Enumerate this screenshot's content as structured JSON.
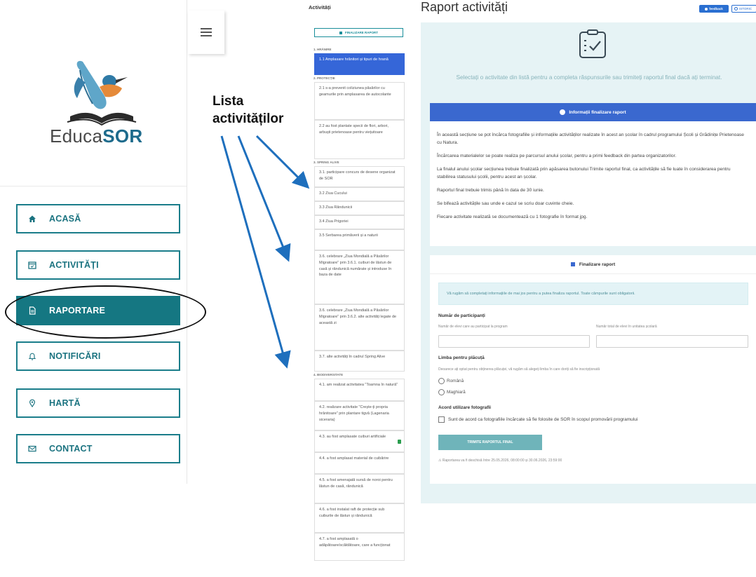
{
  "sidebar": {
    "logo_text_a": "Educa",
    "logo_text_b": "SOR",
    "nav": [
      {
        "label": "ACASĂ",
        "icon": "home-icon"
      },
      {
        "label": "ACTIVITĂȚI",
        "icon": "calendar-icon"
      },
      {
        "label": "RAPORTARE",
        "icon": "document-icon"
      },
      {
        "label": "NOTIFICĂRI",
        "icon": "bell-icon"
      },
      {
        "label": "HARTĂ",
        "icon": "map-pin-icon"
      },
      {
        "label": "CONTACT",
        "icon": "mail-icon"
      }
    ],
    "active": "RAPORTARE"
  },
  "annotation": {
    "line1": "Lista",
    "line2": "activităților"
  },
  "activities": {
    "title": "Activități",
    "finalize_button": "FINALIZARE RAPORT",
    "sections": [
      {
        "heading": "1. HRĂNIRE",
        "items": [
          {
            "text": "1.1 Amplasare hrănitori și tipuri de hrană",
            "active": true
          }
        ]
      },
      {
        "heading": "2. PROTECȚIE",
        "items": [
          {
            "text": "2.1 s-a prevenit coliziunea păsărilor cu geamurile prin amplasarea de autocolante"
          },
          {
            "text": "2.2 au fost plantate specii de flori, arbori, arbuști prietenoase pentru viețuitoare"
          }
        ]
      },
      {
        "heading": "3. SPRING ALIVE",
        "items": [
          {
            "text": "3.1. participare concurs de desene organizat de SOR"
          },
          {
            "text": "3.2 Ziua Cucului"
          },
          {
            "text": "3.3 Ziua Rândunicii"
          },
          {
            "text": "3.4 Ziua Prigoriei"
          },
          {
            "text": "3.5 Serbarea primăverii și a naturii"
          },
          {
            "text": "3.6. celebrare „Ziua Mondială a Păsărilor Migratoare” prin 3.6.1. cuiburi de lăstun de casă și rândunică numărate și introduse în baza de date"
          },
          {
            "text": "3.6. celebrare „Ziua Mondială a Păsărilor Migratoare” prin 3.6.2. alte activități legate de această zi"
          },
          {
            "text": "3.7. alte activități în cadrul Spring Alive"
          }
        ]
      },
      {
        "heading": "4. BIODIVERSITATE",
        "items": [
          {
            "text": "4.1. am realizat activitatea \"Toamna în natură\""
          },
          {
            "text": "4.2. realizare activitate \"Crește-ți propria hrănitoare\" prin plantare tigvă (Lagenaria siceraria)"
          },
          {
            "text": "4.3. au fost amplasate cuiburi artificiale",
            "locked": true
          },
          {
            "text": "4.4. a fost amplasat material de cuibărire"
          },
          {
            "text": "4.5. a fost amenajată sursă de noroi pentru lăstun de casă, rândunică"
          },
          {
            "text": "4.6. a fost instalat raft de protecție sub cuiburile de lăstun și rândunică"
          },
          {
            "text": "4.7. a fost amplasată o adăpătoare/scăldătoare, care a funcționat"
          }
        ]
      }
    ]
  },
  "report": {
    "title": "Raport activități",
    "feedback_button": "feedback",
    "history_button": "ISTORIC",
    "lead": "Selectați o activitate din listă pentru a completa răspunsurile sau trimiteți raportul final dacă ați terminat.",
    "info_title": "Informații finalizare raport",
    "info_paragraphs": [
      "În această secțiune se pot încărca fotografiile și informațiile activităților realizate în acest an școlar în cadrul programului Școli și Grădinițe Prietenoase cu Natura.",
      "Încărcarea materialelor se poate realiza pe parcursul anului școlar, pentru a primi feedback din partea organizatorilor.",
      "La finalul anului școlar secțiunea trebuie finalizată prin apăsarea butonului Trimite raportul final, ca activitățile să fie luate în considerarea pentru stabilirea statusului școlii, pentru acest an școlar.",
      "Raportul final trebuie trimis până în data de 30 iunie.",
      "Se bifează activitățile sau unde e cazul se scriu doar cuvinte cheie.",
      "Fiecare activitate realizată se documentează cu 1 fotografie în format jpg."
    ],
    "final_title": "Finalizare raport",
    "final_note": "Vă rugăm să completați informațiile de mai jos pentru a putea finaliza raportul. Toate câmpurile sunt obligatorii.",
    "participants_label": "Număr de participanți",
    "participants_hint_1": "Număr de elevi care au participat la program",
    "participants_hint_2": "Număr total de elevi în unitatea școlară",
    "participants_value_1": "",
    "participants_value_2": "",
    "language_label": "Limba pentru plăcuță",
    "language_hint": "Deoarece ați optat pentru obținerea plăcuței, vă rugăm să alegeți limba în care doriți să fie inscripționată",
    "language_options": [
      "Română",
      "Maghiară"
    ],
    "photo_label": "Acord utilizare fotografii",
    "photo_consent": "Sunt de acord ca fotografiile încărcate să fie folosite de SOR în scopul promovării programului",
    "submit": "TRIMITE RAPORTUL FINAL",
    "footer": "Raportarea va fi deschisă între 25.05.2026, 08:00:00 și 30.06.2026, 23:59:00"
  }
}
